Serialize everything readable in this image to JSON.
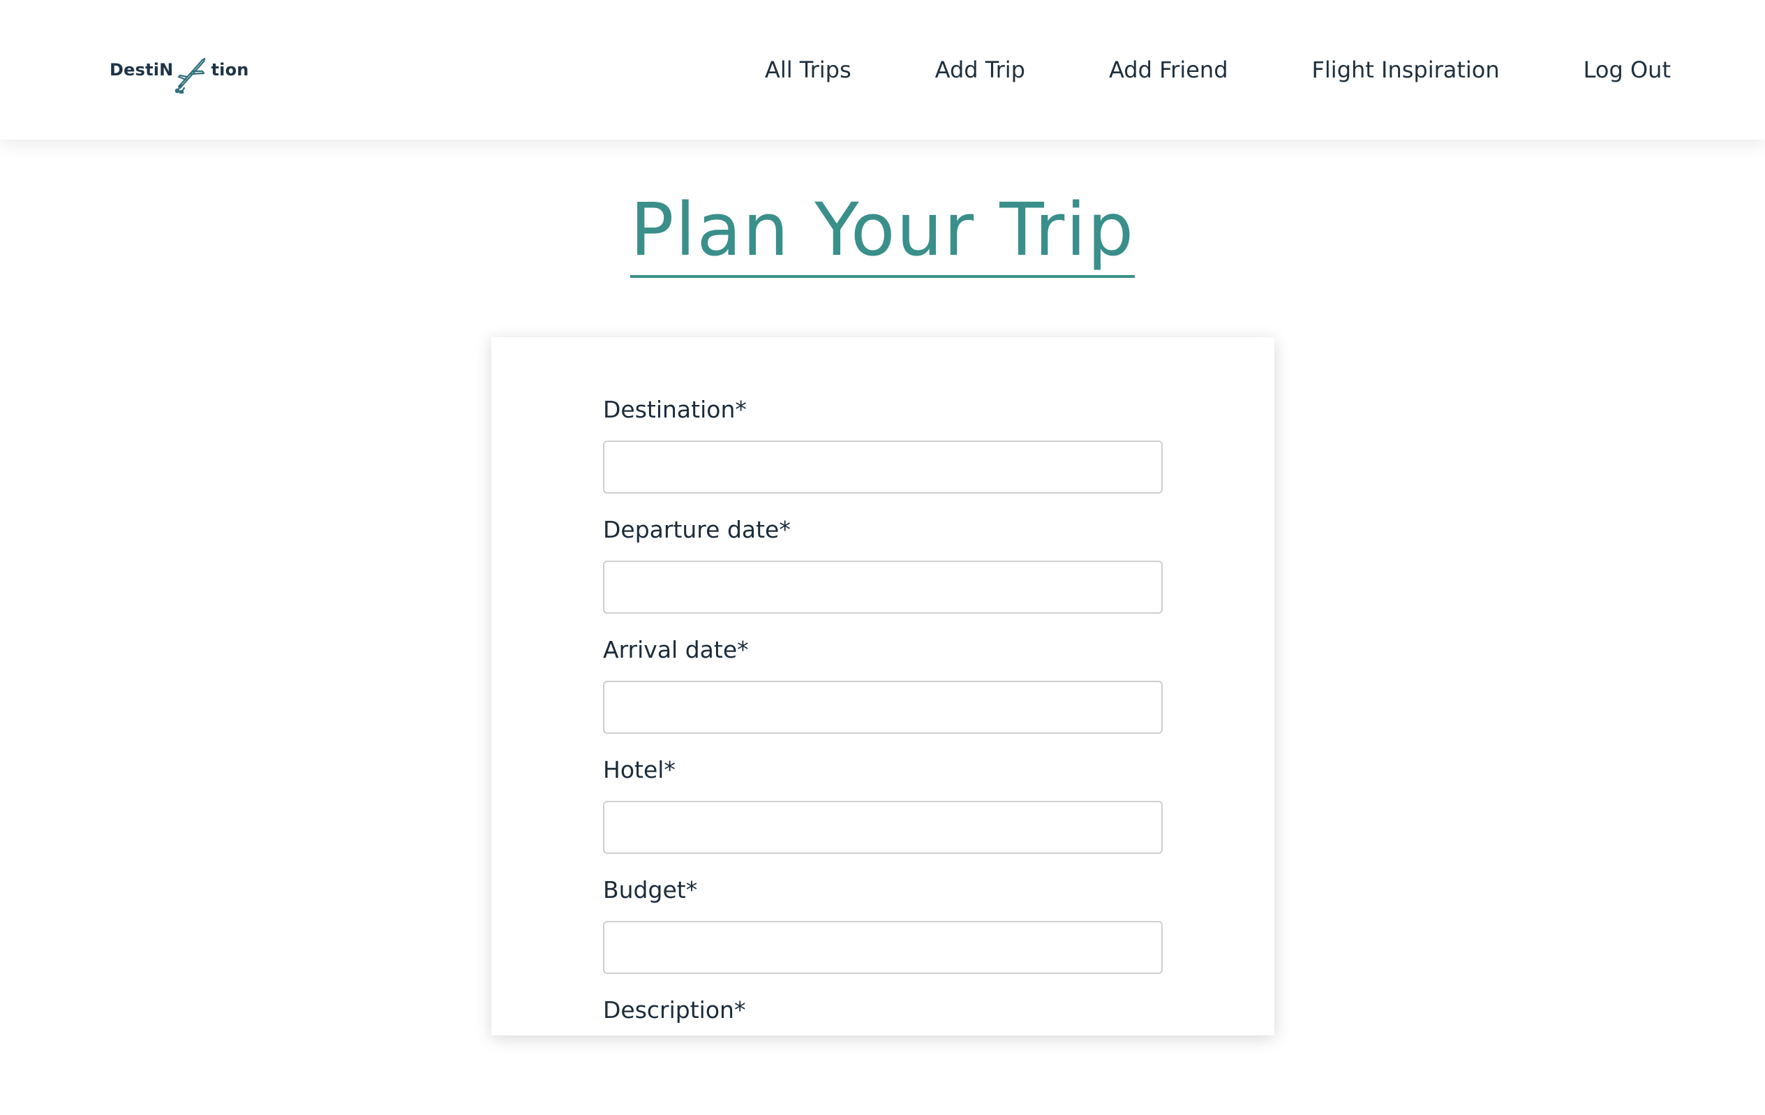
{
  "logo": {
    "text_left": "DestiN",
    "text_right": "tion",
    "icon": "airplane-icon"
  },
  "nav": {
    "items": [
      {
        "label": "All Trips"
      },
      {
        "label": "Add Trip"
      },
      {
        "label": "Add Friend"
      },
      {
        "label": "Flight Inspiration"
      },
      {
        "label": "Log Out"
      }
    ]
  },
  "page": {
    "title": "Plan Your Trip"
  },
  "form": {
    "fields": [
      {
        "label": "Destination*",
        "value": "",
        "placeholder": ""
      },
      {
        "label": "Departure date*",
        "value": "",
        "placeholder": ""
      },
      {
        "label": "Arrival date*",
        "value": "",
        "placeholder": ""
      },
      {
        "label": "Hotel*",
        "value": "",
        "placeholder": ""
      },
      {
        "label": "Budget*",
        "value": "",
        "placeholder": ""
      },
      {
        "label": "Description*",
        "value": "",
        "placeholder": ""
      }
    ]
  },
  "colors": {
    "accent": "#3a8f8a",
    "text": "#1c2b3a",
    "input_border": "#cfcfcf"
  }
}
